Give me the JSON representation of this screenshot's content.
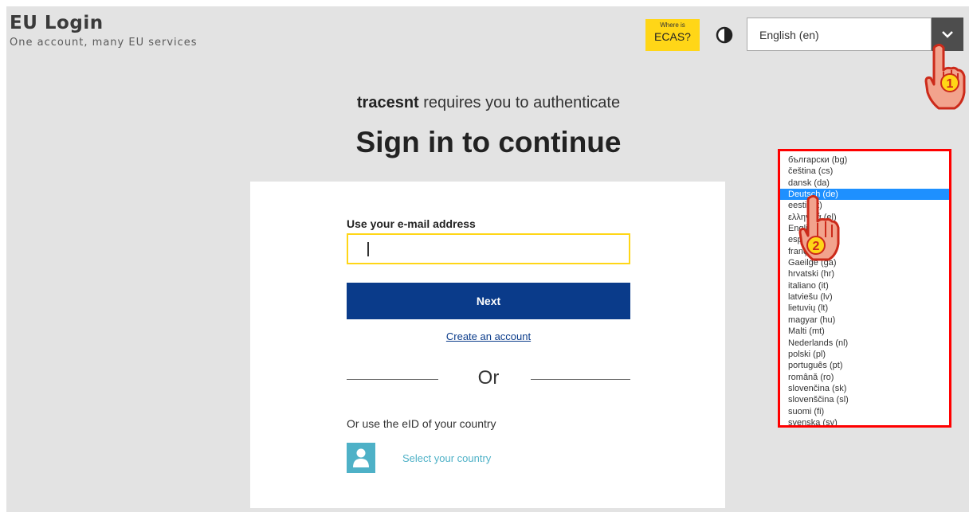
{
  "header": {
    "brand_title": "EU Login",
    "brand_tagline": "One account, many EU services",
    "ecas_small": "Where is",
    "ecas_big": "ECAS?",
    "language_value": "English (en)"
  },
  "main": {
    "service_name": "tracesnt",
    "requires_text": " requires you to authenticate",
    "headline": "Sign in to continue"
  },
  "form": {
    "email_label": "Use your e-mail address",
    "email_value": "",
    "next_label": "Next",
    "create_account": "Create an account",
    "or_label": "Or",
    "eid_label": "Or use the eID of your country",
    "select_country": "Select your country"
  },
  "language_list": {
    "selected": "Deutsch (de)",
    "items": [
      "български (bg)",
      "čeština (cs)",
      "dansk (da)",
      "Deutsch (de)",
      "eesti (et)",
      "ελληνικά (el)",
      "English (en)",
      "español (es)",
      "français (fr)",
      "Gaeilge (ga)",
      "hrvatski (hr)",
      "italiano (it)",
      "latviešu (lv)",
      "lietuvių (lt)",
      "magyar (hu)",
      "Malti (mt)",
      "Nederlands (nl)",
      "polski (pl)",
      "português (pt)",
      "română (ro)",
      "slovenčina (sk)",
      "slovenščina (sl)",
      "suomi (fi)",
      "svenska (sv)"
    ]
  },
  "annotations": {
    "step_1": "1",
    "step_2": "2"
  },
  "colors": {
    "accent_yellow": "#ffd617",
    "primary_blue": "#0a3b8a",
    "highlight_red": "#ff0000",
    "eid_teal": "#4eb1c7"
  }
}
